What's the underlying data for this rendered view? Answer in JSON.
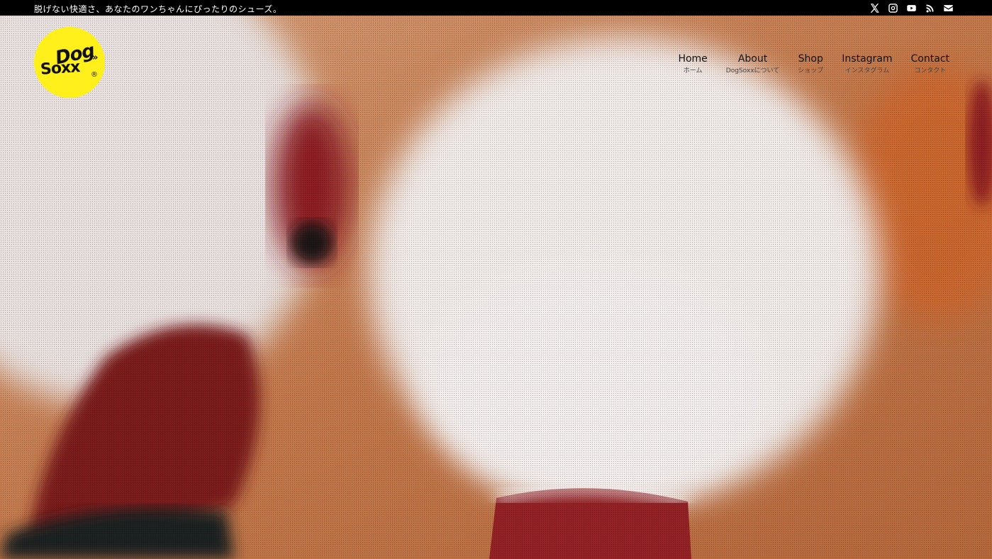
{
  "topbar": {
    "tagline": "脱げない快適さ、あなたのワンちゃんにぴったりのシューズ。",
    "social": [
      {
        "icon": "x-icon"
      },
      {
        "icon": "instagram-icon"
      },
      {
        "icon": "youtube-icon"
      },
      {
        "icon": "rss-icon"
      },
      {
        "icon": "mail-icon"
      }
    ]
  },
  "logo": {
    "line1": "Dog",
    "line2": "Soxx",
    "mark": "»",
    "reg": "®"
  },
  "nav": [
    {
      "en": "Home",
      "ja": "ホーム"
    },
    {
      "en": "About",
      "ja": "DogSoxxについて"
    },
    {
      "en": "Shop",
      "ja": "ショップ"
    },
    {
      "en": "Instagram",
      "ja": "インスタグラム"
    },
    {
      "en": "Contact",
      "ja": "コンタクト"
    }
  ],
  "colors": {
    "topbar": "#000000",
    "logo": "#ffef1a",
    "socks": "#8e1f22",
    "fur": "#f2ecea"
  }
}
